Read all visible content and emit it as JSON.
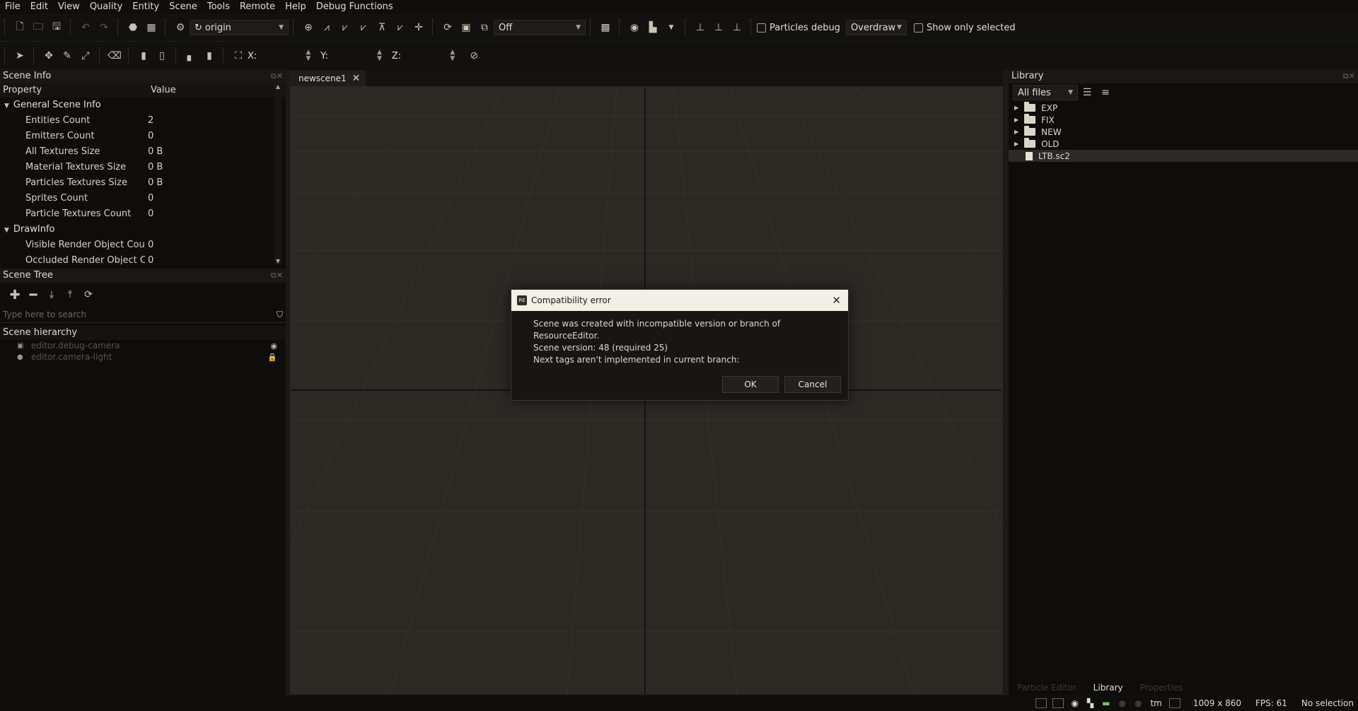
{
  "menu": [
    "File",
    "Edit",
    "View",
    "Quality",
    "Entity",
    "Scene",
    "Tools",
    "Remote",
    "Help",
    "Debug Functions"
  ],
  "toolbar": {
    "origin_combo": "origin",
    "mode_combo": "Off",
    "particles_debug_label": "Particles debug",
    "overdraw_combo": "Overdraw",
    "show_only_selected_label": "Show only selected",
    "x_label": "X:",
    "y_label": "Y:",
    "z_label": "Z:"
  },
  "scene_info": {
    "title": "Scene Info",
    "col_property": "Property",
    "col_value": "Value",
    "groups": [
      {
        "name": "General Scene Info",
        "rows": [
          {
            "property": "Entities Count",
            "value": "2"
          },
          {
            "property": "Emitters Count",
            "value": "0"
          },
          {
            "property": "All Textures Size",
            "value": "0 B"
          },
          {
            "property": "Material Textures Size",
            "value": "0 B"
          },
          {
            "property": "Particles Textures Size",
            "value": "0 B"
          },
          {
            "property": "Sprites Count",
            "value": "0"
          },
          {
            "property": "Particle Textures Count",
            "value": "0"
          }
        ]
      },
      {
        "name": "DrawInfo",
        "rows": [
          {
            "property": "Visible Render Object Count",
            "value": "0"
          },
          {
            "property": "Occluded Render Object C...",
            "value": "0"
          }
        ]
      }
    ]
  },
  "scene_tree": {
    "title": "Scene Tree",
    "search_placeholder": "Type here to search",
    "hierarchy_title": "Scene hierarchy",
    "items": [
      {
        "label": "editor.debug-camera"
      },
      {
        "label": "editor.camera-light"
      }
    ]
  },
  "viewport": {
    "tab_label": "newscene1"
  },
  "library": {
    "title": "Library",
    "filter_combo": "All files",
    "items": [
      {
        "label": "EXP",
        "type": "folder"
      },
      {
        "label": "FIX",
        "type": "folder"
      },
      {
        "label": "NEW",
        "type": "folder"
      },
      {
        "label": "OLD",
        "type": "folder"
      },
      {
        "label": "LTB.sc2",
        "type": "file",
        "selected": true
      }
    ],
    "bottom_tabs": [
      "Particle Editor",
      "Library",
      "Properties"
    ]
  },
  "status": {
    "tm": "tm",
    "resolution": "1009 x 860",
    "fps": "FPS: 61",
    "selection": "No selection"
  },
  "dialog": {
    "title": "Compatibility error",
    "app_icon_text": "RE",
    "lines": [
      "Scene was created with incompatible version or branch of ResourceEditor.",
      "Scene version: 48 (required 25)",
      "Next tags aren't implemented in current branch:"
    ],
    "ok": "OK",
    "cancel": "Cancel"
  }
}
